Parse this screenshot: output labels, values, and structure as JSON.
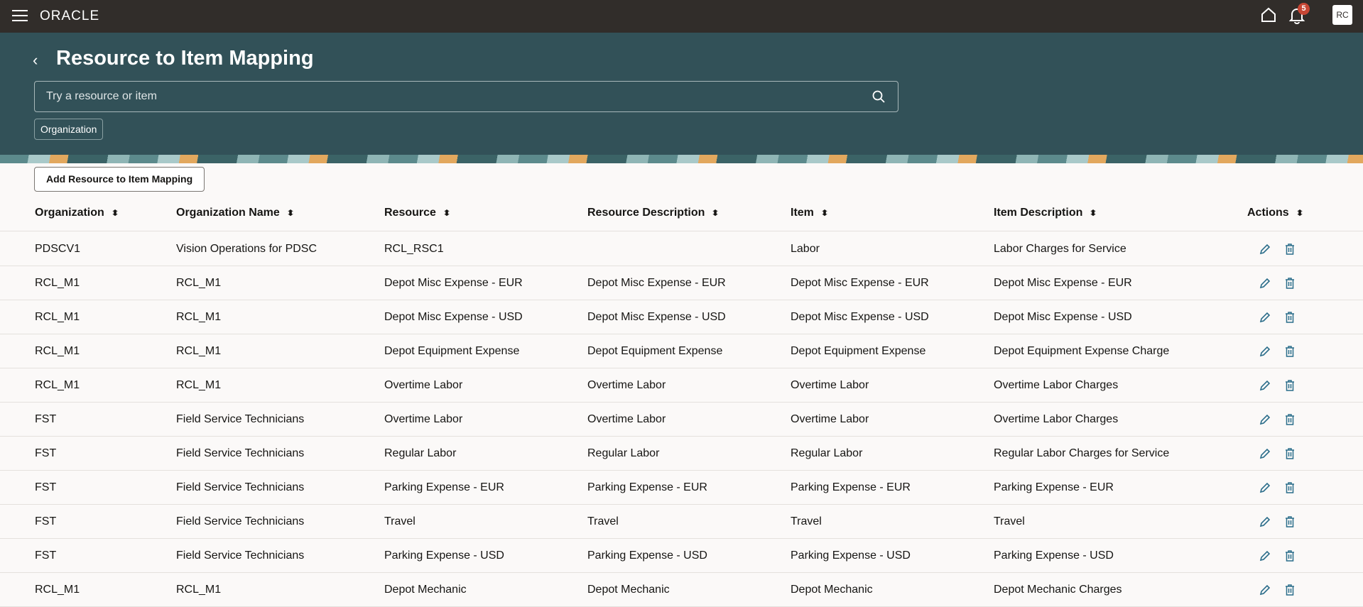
{
  "topbar": {
    "brand": "ORACLE",
    "notification_count": "5",
    "avatar_initials": "RC"
  },
  "page": {
    "title": "Resource to Item Mapping",
    "search_placeholder": "Try a resource or item",
    "filter_chip": "Organization",
    "add_button": "Add Resource to Item Mapping"
  },
  "columns": [
    "Organization",
    "Organization Name",
    "Resource",
    "Resource Description",
    "Item",
    "Item Description",
    "Actions"
  ],
  "rows": [
    [
      "PDSCV1",
      "Vision Operations for PDSC",
      "RCL_RSC1",
      "",
      "Labor",
      "Labor Charges for Service"
    ],
    [
      "RCL_M1",
      "RCL_M1",
      "Depot Misc Expense - EUR",
      "Depot Misc Expense - EUR",
      "Depot Misc Expense - EUR",
      "Depot Misc Expense - EUR"
    ],
    [
      "RCL_M1",
      "RCL_M1",
      "Depot Misc Expense - USD",
      "Depot Misc Expense - USD",
      "Depot Misc Expense - USD",
      "Depot Misc Expense - USD"
    ],
    [
      "RCL_M1",
      "RCL_M1",
      "Depot Equipment Expense",
      "Depot Equipment Expense",
      "Depot Equipment Expense",
      "Depot Equipment Expense Charge"
    ],
    [
      "RCL_M1",
      "RCL_M1",
      "Overtime Labor",
      "Overtime Labor",
      "Overtime Labor",
      "Overtime Labor Charges"
    ],
    [
      "FST",
      "Field Service Technicians",
      "Overtime Labor",
      "Overtime Labor",
      "Overtime Labor",
      "Overtime Labor Charges"
    ],
    [
      "FST",
      "Field Service Technicians",
      "Regular Labor",
      "Regular Labor",
      "Regular Labor",
      "Regular Labor Charges for Service"
    ],
    [
      "FST",
      "Field Service Technicians",
      "Parking Expense - EUR",
      "Parking Expense - EUR",
      "Parking Expense - EUR",
      "Parking Expense - EUR"
    ],
    [
      "FST",
      "Field Service Technicians",
      "Travel",
      "Travel",
      "Travel",
      "Travel"
    ],
    [
      "FST",
      "Field Service Technicians",
      "Parking Expense - USD",
      "Parking Expense - USD",
      "Parking Expense - USD",
      "Parking Expense - USD"
    ],
    [
      "RCL_M1",
      "RCL_M1",
      "Depot Mechanic",
      "Depot Mechanic",
      "Depot Mechanic",
      "Depot Mechanic Charges"
    ]
  ],
  "colors": {
    "topbar": "#312d2a",
    "band": "#325158",
    "accent": "#2b6d8a",
    "badge": "#c74634"
  }
}
